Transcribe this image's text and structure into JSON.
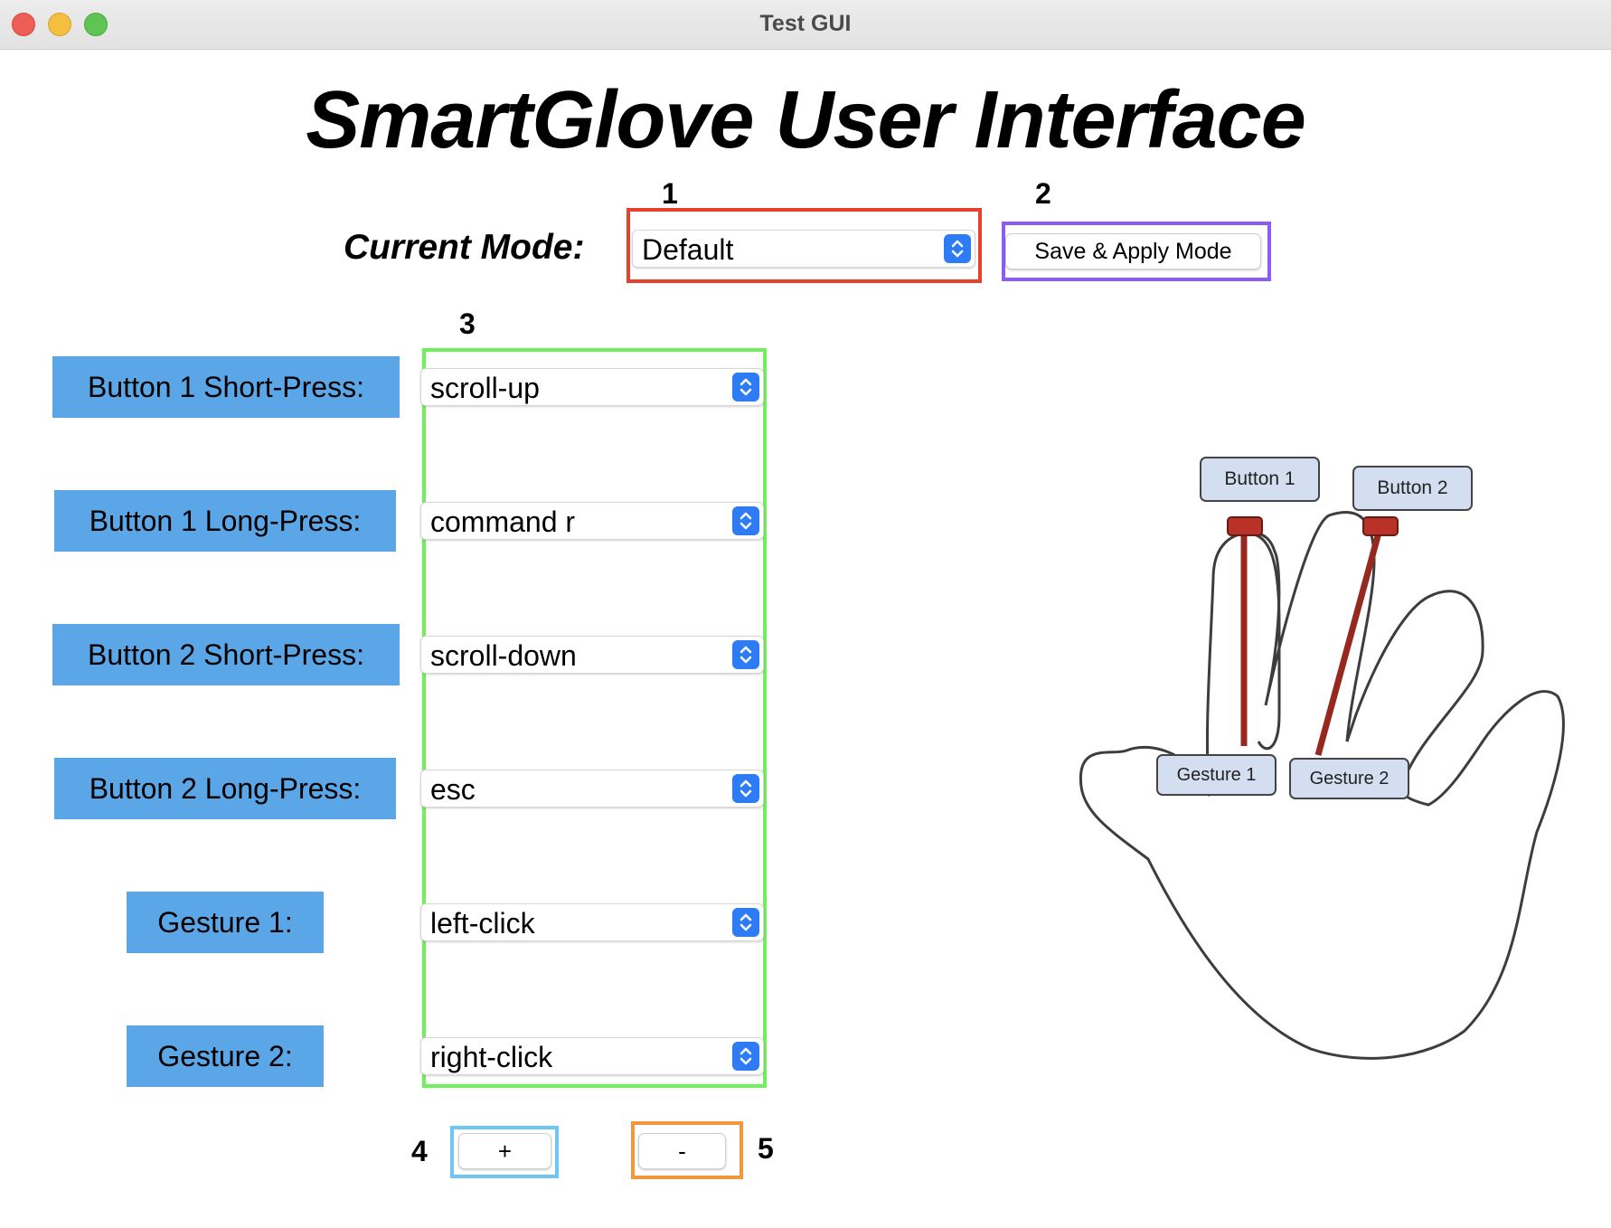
{
  "window": {
    "title": "Test GUI"
  },
  "app": {
    "title": "SmartGlove User Interface"
  },
  "mode": {
    "label": "Current Mode:",
    "selected": "Default",
    "save_button_label": "Save & Apply Mode"
  },
  "annotations": {
    "n1": "1",
    "n2": "2",
    "n3": "3",
    "n4": "4",
    "n5": "5",
    "colors": {
      "mode_dropdown": "#e6412f",
      "save_button": "#8b5cf6",
      "mappings": "#6ef05a",
      "add_button": "#6cc8f2",
      "remove_button": "#f0983a"
    }
  },
  "mappings": [
    {
      "label": "Button 1 Short-Press:",
      "value": "scroll-up"
    },
    {
      "label": "Button 1 Long-Press:",
      "value": "command r"
    },
    {
      "label": "Button 2 Short-Press:",
      "value": "scroll-down"
    },
    {
      "label": "Button 2 Long-Press:",
      "value": "esc"
    },
    {
      "label": "Gesture 1:",
      "value": "left-click"
    },
    {
      "label": "Gesture 2:",
      "value": "right-click"
    }
  ],
  "controls": {
    "add_label": "+",
    "remove_label": "-"
  },
  "hand": {
    "button1": "Button 1",
    "button2": "Button 2",
    "gesture1": "Gesture 1",
    "gesture2": "Gesture 2"
  },
  "colors": {
    "label_bg": "#5aa6e6",
    "stepper_blue": "#2d7cf6",
    "button_red": "#b83227"
  }
}
